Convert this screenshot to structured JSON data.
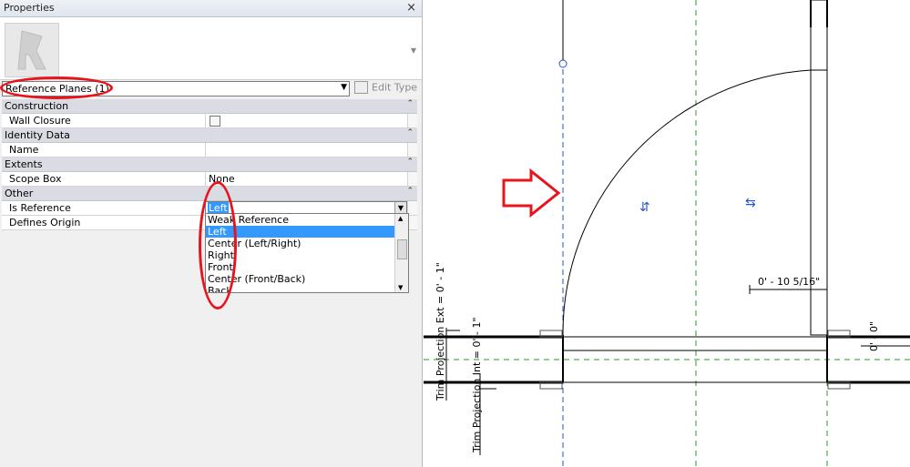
{
  "palette": {
    "title": "Properties",
    "close_glyph": "×",
    "type_selector": {
      "value": "Reference Planes (1)"
    },
    "edit_type_label": "Edit Type",
    "categories": [
      {
        "label": "Construction",
        "rows": [
          {
            "name": "Wall Closure",
            "value": "",
            "kind": "checkbox"
          }
        ]
      },
      {
        "label": "Identity Data",
        "rows": [
          {
            "name": "Name",
            "value": ""
          }
        ]
      },
      {
        "label": "Extents",
        "rows": [
          {
            "name": "Scope Box",
            "value": "None"
          }
        ]
      },
      {
        "label": "Other",
        "rows": [
          {
            "name": "Is Reference",
            "value": "Left",
            "kind": "combo"
          },
          {
            "name": "Defines Origin",
            "value": ""
          }
        ]
      }
    ],
    "is_reference_options": [
      "Weak Reference",
      "Left",
      "Center (Left/Right)",
      "Right",
      "Front",
      "Center (Front/Back)",
      "Back"
    ],
    "is_reference_selected": "Left"
  },
  "drawing": {
    "dimension_width": "0' - 10 5/16\"",
    "dimension_trim_ext": "Trim Projection Ext = 0' - 1\"",
    "dimension_trim_int": "Trim Projection Int = 0' - 1\"",
    "dimension_zero": "0' - 0\"",
    "flip_vertical_glyph": "⇵",
    "flip_horizontal_glyph": "⇆"
  },
  "colors": {
    "highlight": "#e8141c",
    "reference_plane": "#2255cc",
    "center_line": "#2a9a2a",
    "selection": "#3399ff"
  }
}
